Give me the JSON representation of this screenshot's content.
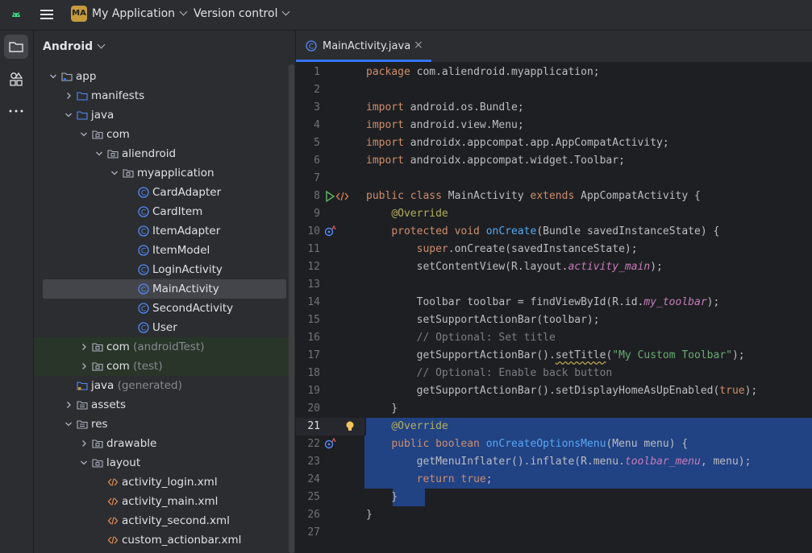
{
  "topbar": {
    "project_badge": "MA",
    "project_name": "My Application",
    "version_control": "Version control"
  },
  "project_panel": {
    "title": "Android",
    "tree": [
      {
        "label": "app",
        "hint": "",
        "depth": 0,
        "expanded": true,
        "icon": "module-folder-icon"
      },
      {
        "label": "manifests",
        "hint": "",
        "depth": 1,
        "expanded": false,
        "icon": "folder-icon"
      },
      {
        "label": "java",
        "hint": "",
        "depth": 1,
        "expanded": true,
        "icon": "folder-icon"
      },
      {
        "label": "com",
        "hint": "",
        "depth": 2,
        "expanded": true,
        "icon": "package-icon"
      },
      {
        "label": "aliendroid",
        "hint": "",
        "depth": 3,
        "expanded": true,
        "icon": "package-icon"
      },
      {
        "label": "myapplication",
        "hint": "",
        "depth": 4,
        "expanded": true,
        "icon": "package-icon"
      },
      {
        "label": "CardAdapter",
        "hint": "",
        "depth": 5,
        "icon": "java-class-icon"
      },
      {
        "label": "CardItem",
        "hint": "",
        "depth": 5,
        "icon": "java-class-icon"
      },
      {
        "label": "ItemAdapter",
        "hint": "",
        "depth": 5,
        "icon": "java-class-icon"
      },
      {
        "label": "ItemModel",
        "hint": "",
        "depth": 5,
        "icon": "java-class-icon"
      },
      {
        "label": "LoginActivity",
        "hint": "",
        "depth": 5,
        "icon": "java-class-icon"
      },
      {
        "label": "MainActivity",
        "hint": "",
        "depth": 5,
        "icon": "java-class-icon",
        "selected": true
      },
      {
        "label": "SecondActivity",
        "hint": "",
        "depth": 5,
        "icon": "java-class-icon"
      },
      {
        "label": "User",
        "hint": "",
        "depth": 5,
        "icon": "java-class-icon"
      },
      {
        "label": "com",
        "hint": "(androidTest)",
        "depth": 2,
        "expanded": false,
        "icon": "package-icon",
        "test": true
      },
      {
        "label": "com",
        "hint": "(test)",
        "depth": 2,
        "expanded": false,
        "icon": "package-icon",
        "test": true
      },
      {
        "label": "java",
        "hint": "(generated)",
        "depth": 1,
        "icon": "generated-folder-icon"
      },
      {
        "label": "assets",
        "hint": "",
        "depth": 1,
        "expanded": false,
        "icon": "resource-folder-icon"
      },
      {
        "label": "res",
        "hint": "",
        "depth": 1,
        "expanded": true,
        "icon": "resource-folder-icon"
      },
      {
        "label": "drawable",
        "hint": "",
        "depth": 2,
        "expanded": false,
        "icon": "package-icon"
      },
      {
        "label": "layout",
        "hint": "",
        "depth": 2,
        "expanded": true,
        "icon": "package-icon"
      },
      {
        "label": "activity_login.xml",
        "hint": "",
        "depth": 3,
        "icon": "xml-file-icon"
      },
      {
        "label": "activity_main.xml",
        "hint": "",
        "depth": 3,
        "icon": "xml-file-icon"
      },
      {
        "label": "activity_second.xml",
        "hint": "",
        "depth": 3,
        "icon": "xml-file-icon"
      },
      {
        "label": "custom_actionbar.xml",
        "hint": "",
        "depth": 3,
        "icon": "xml-file-icon"
      }
    ]
  },
  "editor": {
    "tab_label": "MainActivity.java",
    "current_line": 21,
    "highlight_lines": [
      21,
      22,
      23,
      24,
      25
    ],
    "lines": [
      {
        "n": "1",
        "tokens": [
          [
            "kw",
            "package "
          ],
          [
            "",
            "com.aliendroid.myapplication;"
          ]
        ]
      },
      {
        "n": "2",
        "tokens": []
      },
      {
        "n": "3",
        "tokens": [
          [
            "kw",
            "import "
          ],
          [
            "",
            "android.os.Bundle;"
          ]
        ]
      },
      {
        "n": "4",
        "tokens": [
          [
            "kw",
            "import "
          ],
          [
            "",
            "android.view.Menu;"
          ]
        ]
      },
      {
        "n": "5",
        "tokens": [
          [
            "kw",
            "import "
          ],
          [
            "",
            "androidx.appcompat.app.AppCompatActivity;"
          ]
        ]
      },
      {
        "n": "6",
        "tokens": [
          [
            "kw",
            "import "
          ],
          [
            "",
            "androidx.appcompat.widget.Toolbar;"
          ]
        ]
      },
      {
        "n": "7",
        "tokens": []
      },
      {
        "n": "8",
        "tokens": [
          [
            "kw",
            "public class "
          ],
          [
            "",
            "MainActivity "
          ],
          [
            "kw",
            "extends "
          ],
          [
            "",
            "AppCompatActivity {"
          ]
        ],
        "gutter": "run"
      },
      {
        "n": "9",
        "tokens": [
          [
            "",
            "    "
          ],
          [
            "ann",
            "@Override"
          ]
        ]
      },
      {
        "n": "10",
        "tokens": [
          [
            "",
            "    "
          ],
          [
            "kw",
            "protected void "
          ],
          [
            "fn",
            "onCreate"
          ],
          [
            "",
            "(Bundle savedInstanceState) {"
          ]
        ],
        "gutter": "override"
      },
      {
        "n": "11",
        "tokens": [
          [
            "",
            "        "
          ],
          [
            "kw",
            "super"
          ],
          [
            "",
            ".onCreate(savedInstanceState);"
          ]
        ]
      },
      {
        "n": "12",
        "tokens": [
          [
            "",
            "        setContentView(R.layout."
          ],
          [
            "it",
            "activity_main"
          ],
          [
            "",
            ");"
          ]
        ]
      },
      {
        "n": "13",
        "tokens": []
      },
      {
        "n": "14",
        "tokens": [
          [
            "",
            "        Toolbar toolbar = findViewById(R.id."
          ],
          [
            "it",
            "my_toolbar"
          ],
          [
            "",
            ");"
          ]
        ]
      },
      {
        "n": "15",
        "tokens": [
          [
            "",
            "        setSupportActionBar(toolbar);"
          ]
        ]
      },
      {
        "n": "16",
        "tokens": [
          [
            "",
            "        "
          ],
          [
            "cm",
            "// Optional: Set title"
          ]
        ]
      },
      {
        "n": "17",
        "tokens": [
          [
            "",
            "        getSupportActionBar()."
          ],
          [
            "wavy",
            "setTitle"
          ],
          [
            "",
            "("
          ],
          [
            "str",
            "\"My Custom Toolbar\""
          ],
          [
            "",
            ");"
          ]
        ]
      },
      {
        "n": "18",
        "tokens": [
          [
            "",
            "        "
          ],
          [
            "cm",
            "// Optional: Enable back button"
          ]
        ]
      },
      {
        "n": "19",
        "tokens": [
          [
            "",
            "        getSupportActionBar().setDisplayHomeAsUpEnabled("
          ],
          [
            "kw",
            "true"
          ],
          [
            "",
            ");"
          ]
        ]
      },
      {
        "n": "20",
        "tokens": [
          [
            "",
            "    }"
          ]
        ]
      },
      {
        "n": "21",
        "tokens": [
          [
            "",
            "    "
          ],
          [
            "ann",
            "@Override"
          ]
        ],
        "gutter": "bulb"
      },
      {
        "n": "22",
        "tokens": [
          [
            "",
            "    "
          ],
          [
            "kw",
            "public boolean "
          ],
          [
            "fn",
            "onCreateOptionsMenu"
          ],
          [
            "",
            "(Menu menu) {"
          ]
        ],
        "gutter": "override"
      },
      {
        "n": "23",
        "tokens": [
          [
            "",
            "        getMenuInflater().inflate(R.menu."
          ],
          [
            "it",
            "toolbar_menu"
          ],
          [
            "",
            ", menu);"
          ]
        ]
      },
      {
        "n": "24",
        "tokens": [
          [
            "",
            "        "
          ],
          [
            "kw",
            "return true"
          ],
          [
            "",
            ";"
          ]
        ]
      },
      {
        "n": "25",
        "tokens": [
          [
            "",
            "    }"
          ]
        ]
      },
      {
        "n": "26",
        "tokens": [
          [
            "",
            "}"
          ]
        ]
      },
      {
        "n": "27",
        "tokens": []
      }
    ]
  },
  "colors": {
    "accent": "#3574f0",
    "selection": "#214283",
    "keyword": "#cf8e6d",
    "annotation": "#b3ae60",
    "function": "#56a8f5",
    "string": "#6aab73"
  }
}
